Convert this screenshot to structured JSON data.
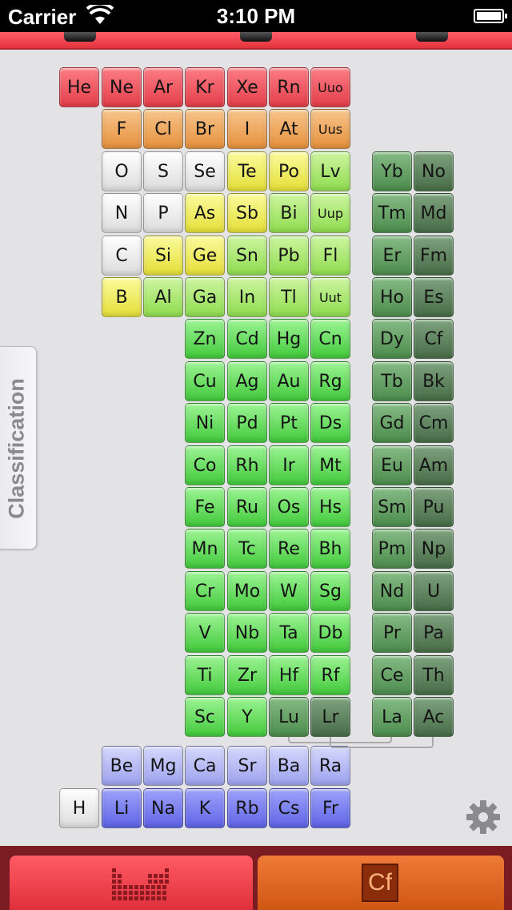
{
  "status_bar": {
    "carrier": "Carrier",
    "time": "3:10 PM"
  },
  "side_tab": {
    "label": "Classification"
  },
  "tab_bar": {
    "element_tab_symbol": "Cf"
  },
  "icons": [
    "wifi-icon",
    "battery-icon",
    "gear-icon",
    "table-view-icon",
    "element-view-icon"
  ],
  "colors": {
    "noble_gas": "#f0545e",
    "halogen": "#ef9d4f",
    "nonmetal": "#f2f2f2",
    "metalloid": "#f0ec5e",
    "post_transition": "#a9e66a",
    "transition": "#5fd656",
    "lanthanide": "#66a366",
    "actinide": "#5f855f",
    "alkaline_earth": "#b6b9f4",
    "alkali": "#7a7ef0",
    "top_strip": "#f0404b",
    "element_tab": "#e2662a"
  },
  "groups": {
    "noble": [
      "He",
      "Ne",
      "Ar",
      "Kr",
      "Xe",
      "Rn",
      "Uuo"
    ],
    "halogens": [
      "F",
      "Cl",
      "Br",
      "I",
      "At",
      "Uus"
    ],
    "group16": [
      "O",
      "S",
      "Se",
      "Te",
      "Po",
      "Lv"
    ],
    "group15": [
      "N",
      "P",
      "As",
      "Sb",
      "Bi",
      "Uup"
    ],
    "group14": [
      "C",
      "Si",
      "Ge",
      "Sn",
      "Pb",
      "Fl"
    ],
    "group13": [
      "B",
      "Al",
      "Ga",
      "In",
      "Tl",
      "Uut"
    ],
    "transition_rows": [
      [
        "Zn",
        "Cd",
        "Hg",
        "Cn"
      ],
      [
        "Cu",
        "Ag",
        "Au",
        "Rg"
      ],
      [
        "Ni",
        "Pd",
        "Pt",
        "Ds"
      ],
      [
        "Co",
        "Rh",
        "Ir",
        "Mt"
      ],
      [
        "Fe",
        "Ru",
        "Os",
        "Hs"
      ],
      [
        "Mn",
        "Tc",
        "Re",
        "Bh"
      ],
      [
        "Cr",
        "Mo",
        "W",
        "Sg"
      ],
      [
        "V",
        "Nb",
        "Ta",
        "Db"
      ],
      [
        "Ti",
        "Zr",
        "Hf",
        "Rf"
      ],
      [
        "Sc",
        "Y",
        "Lu",
        "Lr"
      ]
    ],
    "fblock_rows": [
      [
        "Yb",
        "No"
      ],
      [
        "Tm",
        "Md"
      ],
      [
        "Er",
        "Fm"
      ],
      [
        "Ho",
        "Es"
      ],
      [
        "Dy",
        "Cf"
      ],
      [
        "Tb",
        "Bk"
      ],
      [
        "Gd",
        "Cm"
      ],
      [
        "Eu",
        "Am"
      ],
      [
        "Sm",
        "Pu"
      ],
      [
        "Pm",
        "Np"
      ],
      [
        "Nd",
        "U"
      ],
      [
        "Pr",
        "Pa"
      ],
      [
        "Ce",
        "Th"
      ],
      [
        "La",
        "Ac"
      ]
    ],
    "alkaline_earth": [
      "Be",
      "Mg",
      "Ca",
      "Sr",
      "Ba",
      "Ra"
    ],
    "alkali": [
      "Li",
      "Na",
      "K",
      "Rb",
      "Cs",
      "Fr"
    ],
    "hydrogen": "H"
  }
}
